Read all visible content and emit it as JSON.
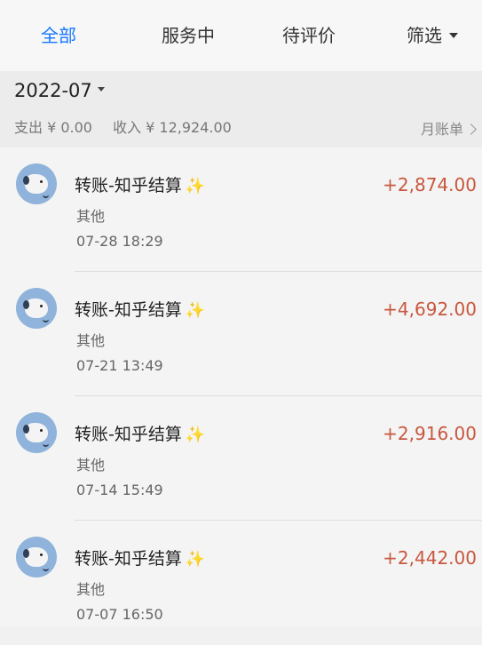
{
  "tabs": [
    {
      "label": "全部",
      "active": true
    },
    {
      "label": "服务中",
      "active": false
    },
    {
      "label": "待评价",
      "active": false
    },
    {
      "label": "筛选",
      "active": false
    }
  ],
  "summary": {
    "month": "2022-07",
    "expense": "支出 ¥ 0.00",
    "income": "收入 ¥ 12,924.00",
    "monthly_bill": "月账单"
  },
  "transactions": [
    {
      "title": "转账-知乎结算",
      "category": "其他",
      "time": "07-28 18:29",
      "amount": "+2,874.00"
    },
    {
      "title": "转账-知乎结算",
      "category": "其他",
      "time": "07-21 13:49",
      "amount": "+4,692.00"
    },
    {
      "title": "转账-知乎结算",
      "category": "其他",
      "time": "07-14 15:49",
      "amount": "+2,916.00"
    },
    {
      "title": "转账-知乎结算",
      "category": "其他",
      "time": "07-07 16:50",
      "amount": "+2,442.00"
    }
  ],
  "colors": {
    "active_tab": "#1677ff",
    "amount": "#c8573e",
    "avatar": "#8fb3da"
  },
  "icons": {
    "sparkle": "sparkle-icon",
    "avatar": "avatar-icon"
  }
}
